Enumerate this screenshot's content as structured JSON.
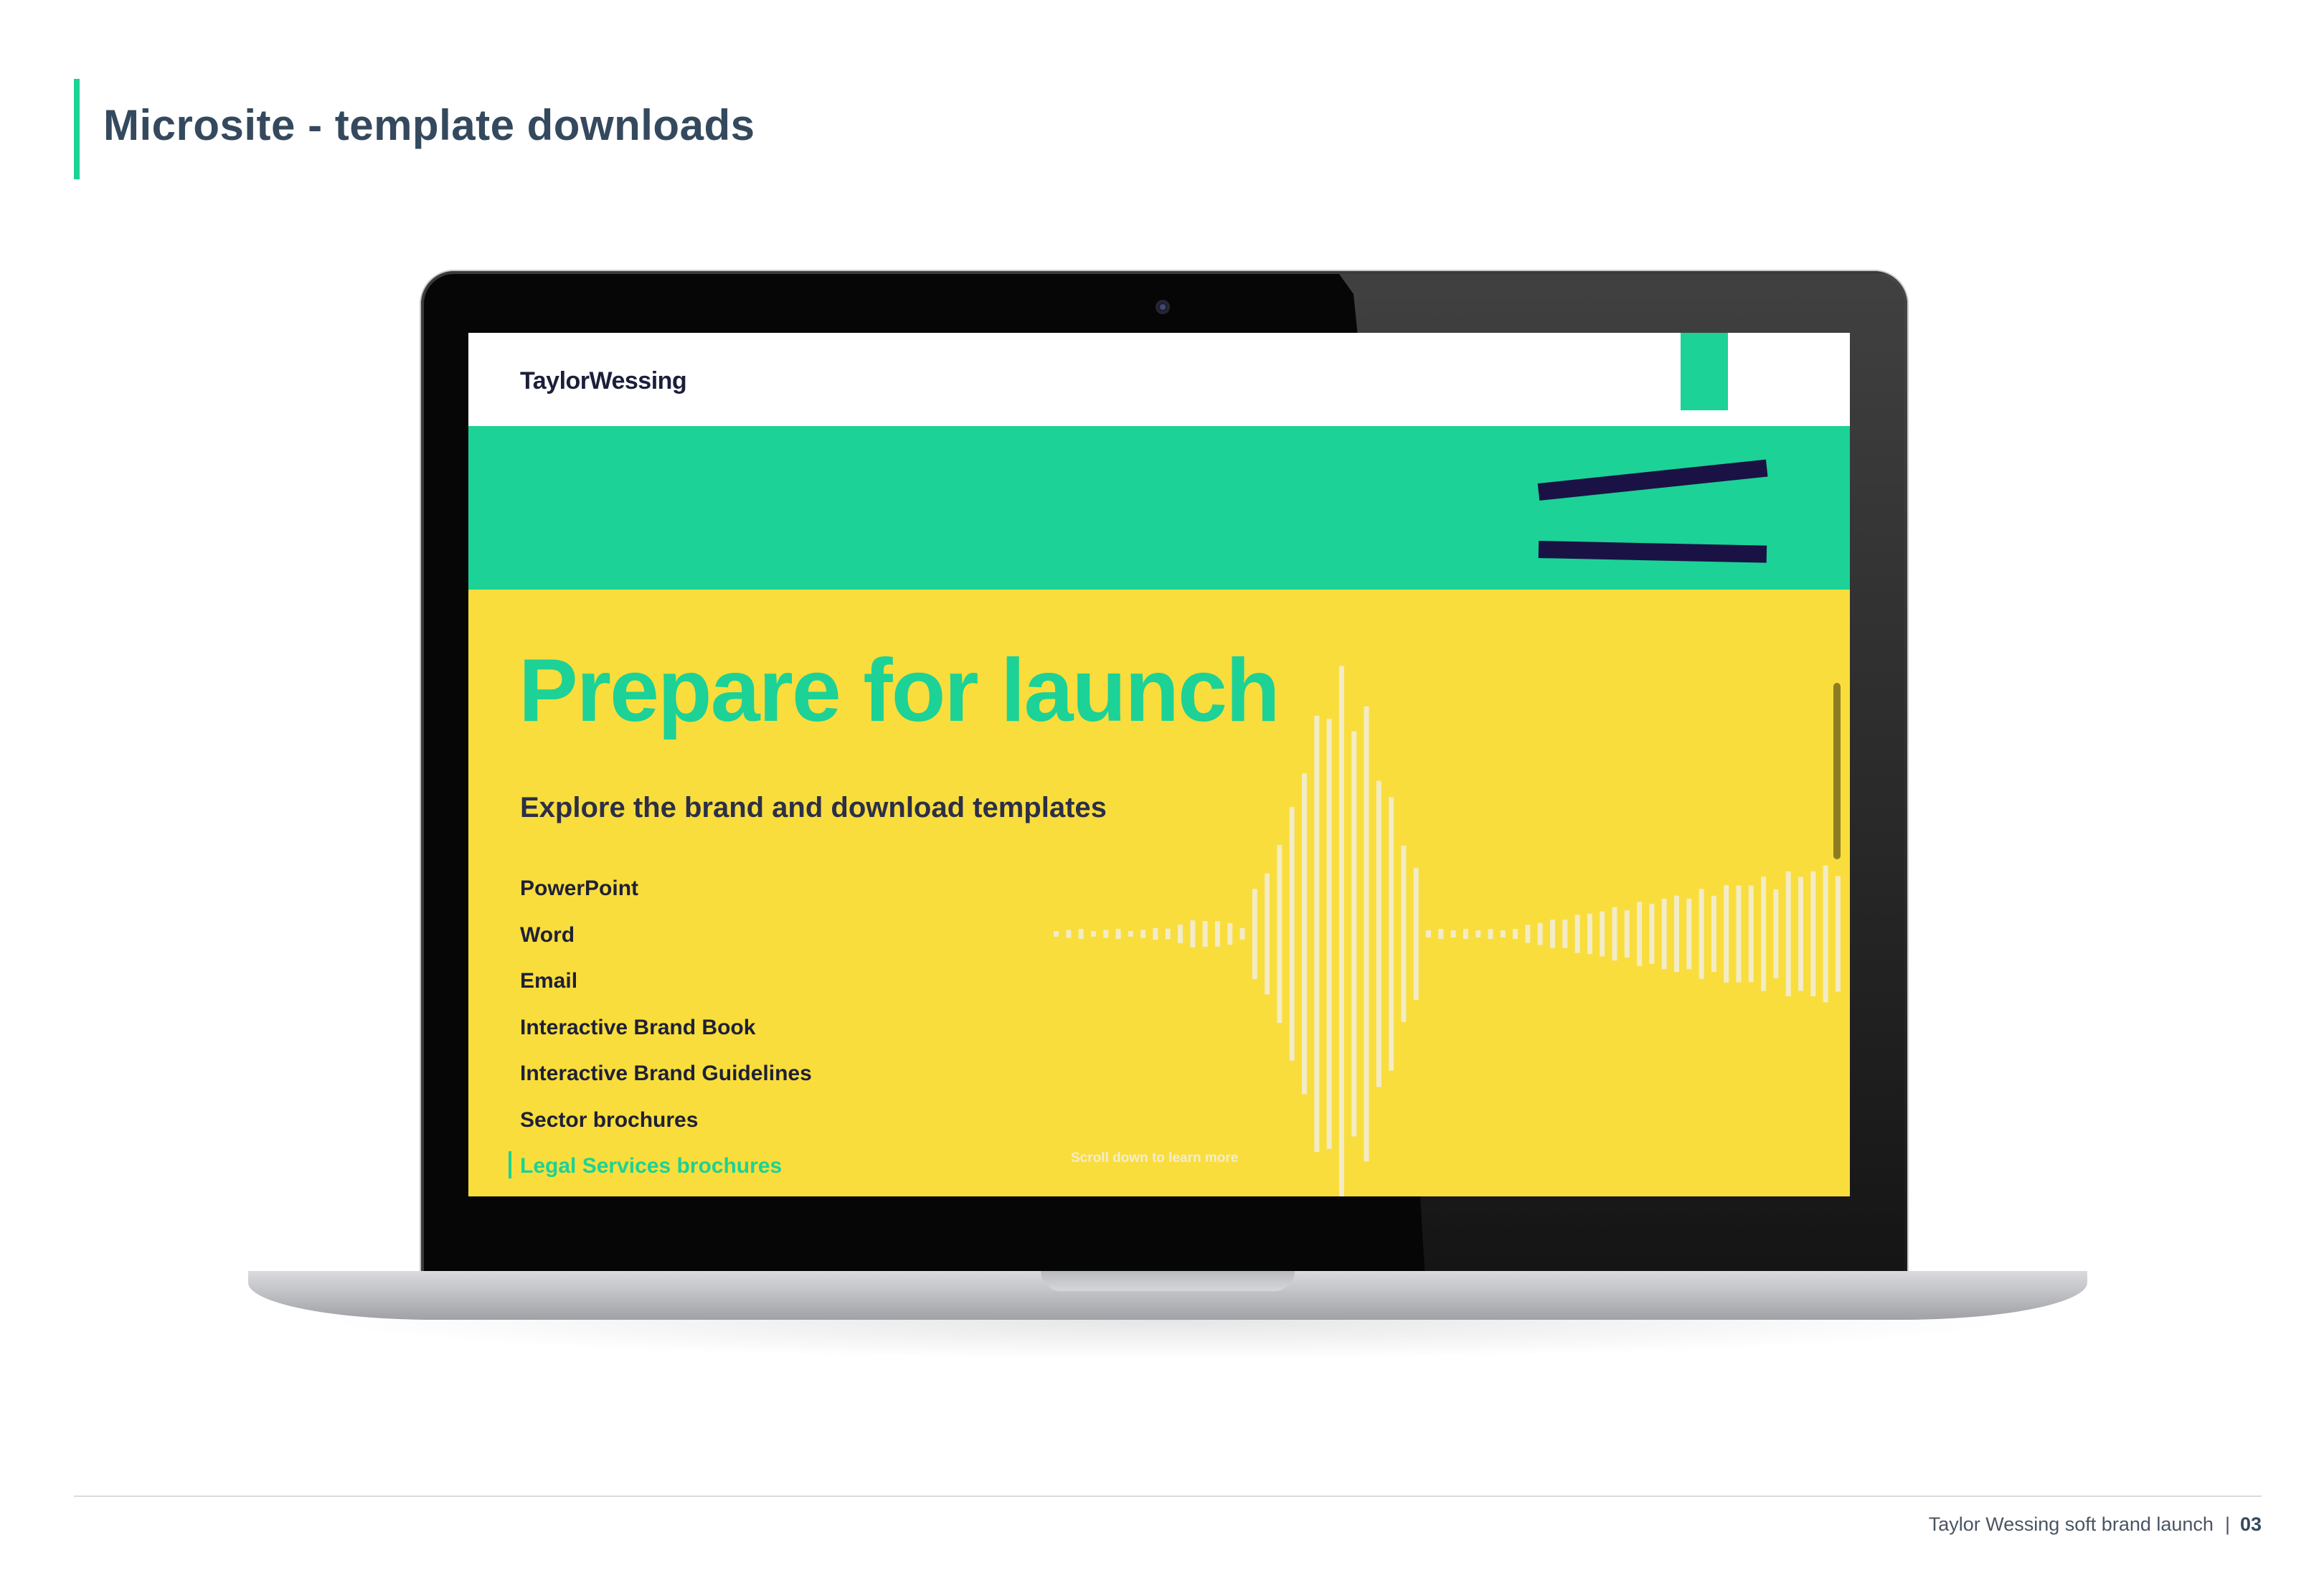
{
  "slide": {
    "title": "Microsite - template downloads",
    "accent_color": "#1cd296"
  },
  "microsite": {
    "brand_logo": "TaylorWessing",
    "hero": {
      "title": "Prepare for launch",
      "subtitle": "Explore the brand and download templates",
      "scroll_hint": "Scroll down to learn more"
    },
    "menu": [
      {
        "label": "PowerPoint",
        "active": false
      },
      {
        "label": "Word",
        "active": false
      },
      {
        "label": "Email",
        "active": false
      },
      {
        "label": "Interactive Brand Book",
        "active": false
      },
      {
        "label": "Interactive Brand Guidelines",
        "active": false
      },
      {
        "label": "Sector brochures",
        "active": false
      },
      {
        "label": "Legal Services brochures",
        "active": true
      }
    ],
    "colors": {
      "green": "#1cd296",
      "yellow": "#f9dd3c",
      "navy": "#1a1245"
    }
  },
  "footer": {
    "text": "Taylor Wessing soft brand launch",
    "separator": "|",
    "page_number": "03"
  }
}
